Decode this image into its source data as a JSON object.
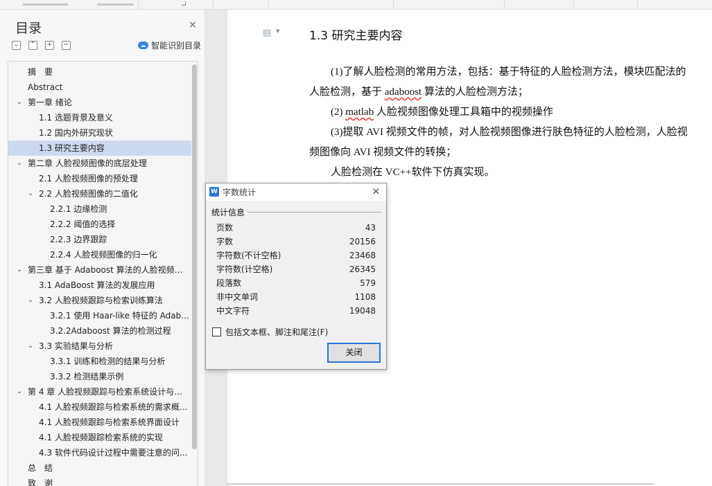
{
  "sidebar": {
    "title": "目录",
    "close_glyph": "×",
    "tools": [
      "⌄",
      "⌃",
      "+",
      "−"
    ],
    "smart_label": "智能识别目录",
    "smart_icon": "cloud-icon",
    "items": [
      {
        "label": "摘　要",
        "level": 0,
        "chevron": "",
        "selected": false
      },
      {
        "label": "Abstract",
        "level": 0,
        "chevron": "",
        "selected": false
      },
      {
        "label": "第一章  绪论",
        "level": 0,
        "chevron": "⌄",
        "selected": false
      },
      {
        "label": "1.1 选题背景及意义",
        "level": 1,
        "chevron": "",
        "selected": false
      },
      {
        "label": "1.2 国内外研究现状",
        "level": 1,
        "chevron": "",
        "selected": false
      },
      {
        "label": "1.3 研究主要内容",
        "level": 1,
        "chevron": "",
        "selected": true
      },
      {
        "label": "第二章  人脸视频图像的底层处理",
        "level": 0,
        "chevron": "⌄",
        "selected": false
      },
      {
        "label": "2.1 人脸视频图像的预处理",
        "level": 1,
        "chevron": "",
        "selected": false
      },
      {
        "label": "2.2 人脸视频图像的二值化",
        "level": 1,
        "chevron": "⌄",
        "selected": false
      },
      {
        "label": "2.2.1 边缘检测",
        "level": 2,
        "chevron": "",
        "selected": false
      },
      {
        "label": "2.2.2 阈值的选择",
        "level": 2,
        "chevron": "",
        "selected": false
      },
      {
        "label": "2.2.3 边界跟踪",
        "level": 2,
        "chevron": "",
        "selected": false
      },
      {
        "label": "2.2.4 人脸视频图像的归一化",
        "level": 2,
        "chevron": "",
        "selected": false
      },
      {
        "label": "第三章  基于 Adaboost 算法的人脸视频…",
        "level": 0,
        "chevron": "⌄",
        "selected": false
      },
      {
        "label": "3.1 AdaBoost 算法的发展应用",
        "level": 1,
        "chevron": "",
        "selected": false
      },
      {
        "label": "3.2  人脸视频跟踪与检索训练算法",
        "level": 1,
        "chevron": "⌄",
        "selected": false
      },
      {
        "label": "3.2.1 使用 Haar-like 特征的 Adab…",
        "level": 2,
        "chevron": "",
        "selected": false
      },
      {
        "label": "3.2.2Adaboost 算法的检测过程",
        "level": 2,
        "chevron": "",
        "selected": false
      },
      {
        "label": "3.3 实验结果与分析",
        "level": 1,
        "chevron": "⌄",
        "selected": false
      },
      {
        "label": "3.3.1 训练和检测的结果与分析",
        "level": 2,
        "chevron": "",
        "selected": false
      },
      {
        "label": "3.3.2 检测结果示例",
        "level": 2,
        "chevron": "",
        "selected": false
      },
      {
        "label": "第 4 章  人脸视频跟踪与检索系统设计与…",
        "level": 0,
        "chevron": "⌄",
        "selected": false
      },
      {
        "label": "4.1 人脸视频跟踪与检索系统的需求概…",
        "level": 1,
        "chevron": "",
        "selected": false
      },
      {
        "label": "4.1 人脸视频跟踪与检索系统界面设计",
        "level": 1,
        "chevron": "",
        "selected": false
      },
      {
        "label": "4.1 人脸视频跟踪检索系统的实现",
        "level": 1,
        "chevron": "",
        "selected": false
      },
      {
        "label": "4.3 软件代码设计过程中需要注意的问…",
        "level": 1,
        "chevron": "",
        "selected": false
      },
      {
        "label": "总　结",
        "level": 0,
        "chevron": "",
        "selected": false
      },
      {
        "label": "致　谢",
        "level": 0,
        "chevron": "",
        "selected": false
      }
    ]
  },
  "document": {
    "heading": "1.3 研究主要内容",
    "p1_pre": "(1)了解人脸检测的常用方法，包括：基于特征的人脸检测方法，模块匹配法的人脸检测，基于 ",
    "p1_word": "adaboost",
    "p1_post": " 算法的人脸检测方法；",
    "p2_pre": "(2) ",
    "p2_word": "matlab",
    "p2_post": " 人脸视频图像处理工具箱中的视频操作",
    "p3": "(3)提取 AVI 视频文件的帧，对人脸视频图像进行肤色特征的人脸检测，人脸视频图像向 AVI 视频文件的转换；",
    "p4": "人脸检测在 VC++软件下仿真实现。"
  },
  "dialog": {
    "title": "字数统计",
    "logo": "W",
    "close_glyph": "×",
    "group_label": "统计信息",
    "stats": [
      {
        "label": "页数",
        "value": "43"
      },
      {
        "label": "字数",
        "value": "20156"
      },
      {
        "label": "字符数(不计空格)",
        "value": "23468"
      },
      {
        "label": "字符数(计空格)",
        "value": "26345"
      },
      {
        "label": "段落数",
        "value": "579"
      },
      {
        "label": "非中文单词",
        "value": "1108"
      },
      {
        "label": "中文字符",
        "value": "19048"
      }
    ],
    "checkbox_label": "包括文本框、脚注和尾注(F)",
    "checkbox_checked": false,
    "close_button": "关闭"
  }
}
